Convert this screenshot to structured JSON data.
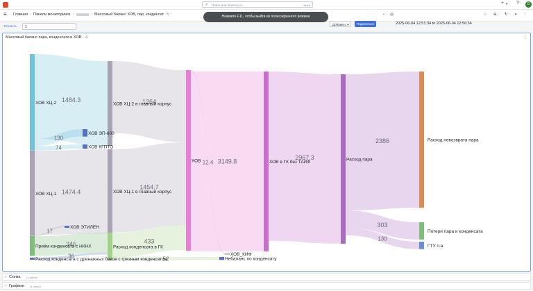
{
  "search": {
    "placeholder": "Поиск или переход к...",
    "shortcut": "ctrl+k"
  },
  "breadcrumb": {
    "home": "Главная",
    "dashboards": "Панели мониторинга",
    "title": "Массовый баланс ХОВ, пар, конденсат"
  },
  "toast": "Нажмите F11, чтобы выйти из полноэкранного режима",
  "toolbar": {
    "add_label": "Добавить",
    "share_label": "Поделиться"
  },
  "time_range": "2025-06-04 12:51:34 to 2025-06-04 12:56:34",
  "variable": {
    "label": "Точность",
    "value": "1"
  },
  "panel": {
    "title": "Массовый баланс пара, конденсата и ХОВ"
  },
  "rows": [
    {
      "title": "Схема",
      "count": "(1 panel)"
    },
    {
      "title": "Графики",
      "count": "(1 panel)"
    }
  ],
  "colors": {
    "accent": "#3d71d9",
    "brand": "#e14a2d"
  },
  "chart_data": {
    "type": "sankey",
    "nodes": [
      {
        "id": "hcz2",
        "label": "ХОВ ХЦ-2",
        "color": "#72c2dc"
      },
      {
        "id": "hcz1",
        "label": "ХОВ ХЦ-1",
        "color": "#a9a3b3"
      },
      {
        "id": "nknh",
        "label": "Приём конденсата с НКНХ",
        "color": "#7fbd7a"
      },
      {
        "id": "drain",
        "label": "Расход конденсата с дренажных баков с грязным конденсатом",
        "color": "#5572c4"
      },
      {
        "id": "ep600",
        "label": "ХОВ ЭП-600",
        "color": "#5572c4"
      },
      {
        "id": "kgpto",
        "label": "ХОВ КГПТО",
        "color": "#5572c4"
      },
      {
        "id": "etilen",
        "label": "ХОВ ЭТИЛЕН",
        "color": "#5572c4"
      },
      {
        "id": "main2",
        "label": "ХОВ ХЦ-2 в главный корпус",
        "color": "#a9a3b3"
      },
      {
        "id": "main1",
        "label": "ХОВ ХЦ-1 в главный корпус",
        "color": "#a9a3b3"
      },
      {
        "id": "gkcond",
        "label": "Расход конденсата в ГК",
        "color": "#a3d38a"
      },
      {
        "id": "hov",
        "label": "ХОВ",
        "color": "#e77fd5"
      },
      {
        "id": "kif",
        "label": "ХОВ_КИФ",
        "color": "#c5c8cc"
      },
      {
        "id": "nebal",
        "label": "Небаланс по конденсату",
        "color": "#5572c4"
      },
      {
        "id": "gk",
        "label": "ХОВ в ГК без ТАИФ",
        "color": "#c86fcc"
      },
      {
        "id": "steam",
        "label": "Расход пара",
        "color": "#a96bbf"
      },
      {
        "id": "nonret",
        "label": "Расход невозврата пара",
        "color": "#d98d56"
      },
      {
        "id": "loss",
        "label": "Потери пара и конденсата",
        "color": "#7fbd7a"
      },
      {
        "id": "gtu",
        "label": "ГТУ п.в.",
        "color": "#6b8fd0"
      }
    ],
    "links": [
      {
        "source": "hcz2",
        "target": "main2",
        "value": 1484.3
      },
      {
        "source": "hcz2",
        "target": "ep600",
        "value": 130
      },
      {
        "source": "hcz2",
        "target": "kgpto",
        "value": 74
      },
      {
        "source": "hcz1",
        "target": "main1",
        "value": 1474.4
      },
      {
        "source": "hcz1",
        "target": "etilen",
        "value": 17
      },
      {
        "source": "nknh",
        "target": "gkcond",
        "value": 346
      },
      {
        "source": "drain",
        "target": "gkcond",
        "value": 36
      },
      {
        "source": "main2",
        "target": "hov",
        "value": 1264.0
      },
      {
        "source": "main1",
        "target": "hov",
        "value": 1454.7
      },
      {
        "source": "gkcond",
        "target": "hov",
        "value": 433
      },
      {
        "source": "gkcond",
        "target": "nebal",
        "value": 52
      },
      {
        "source": "hov",
        "target": "kif",
        "value": 12.4
      },
      {
        "source": "hov",
        "target": "gk",
        "value": 3149.8
      },
      {
        "source": "gk",
        "target": "steam",
        "value": 2967.3
      },
      {
        "source": "steam",
        "target": "nonret",
        "value": 2386.0
      },
      {
        "source": "steam",
        "target": "loss",
        "value": 303
      },
      {
        "source": "steam",
        "target": "gtu",
        "value": 130
      }
    ]
  }
}
